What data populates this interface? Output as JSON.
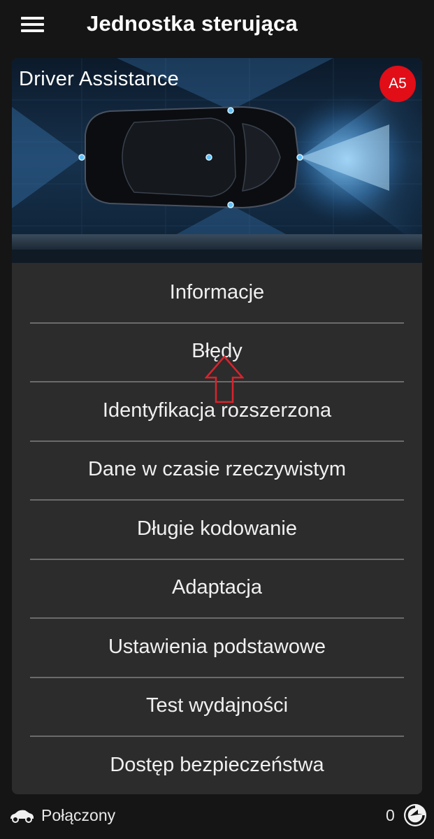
{
  "appbar": {
    "title": "Jednostka sterująca",
    "menu_icon": "hamburger-menu-icon"
  },
  "module": {
    "name": "Driver Assistance",
    "badge": "A5",
    "badge_color": "#e10d17",
    "image": "car-sensors-illustration"
  },
  "menu": {
    "items": [
      {
        "label": "Informacje"
      },
      {
        "label": "Błędy"
      },
      {
        "label": "Identyfikacja rozszerzona"
      },
      {
        "label": "Dane w czasie rzeczywistym"
      },
      {
        "label": "Długie kodowanie"
      },
      {
        "label": "Adaptacja"
      },
      {
        "label": "Ustawienia podstawowe"
      },
      {
        "label": "Test wydajności"
      },
      {
        "label": "Dostęp bezpieczeństwa"
      }
    ]
  },
  "annotation": {
    "icon": "up-arrow-annotation-icon",
    "color": "#d9232d"
  },
  "status": {
    "connection": "Połączony",
    "connection_icon": "car-icon",
    "count": "0",
    "action_icon": "refresh-icon"
  }
}
